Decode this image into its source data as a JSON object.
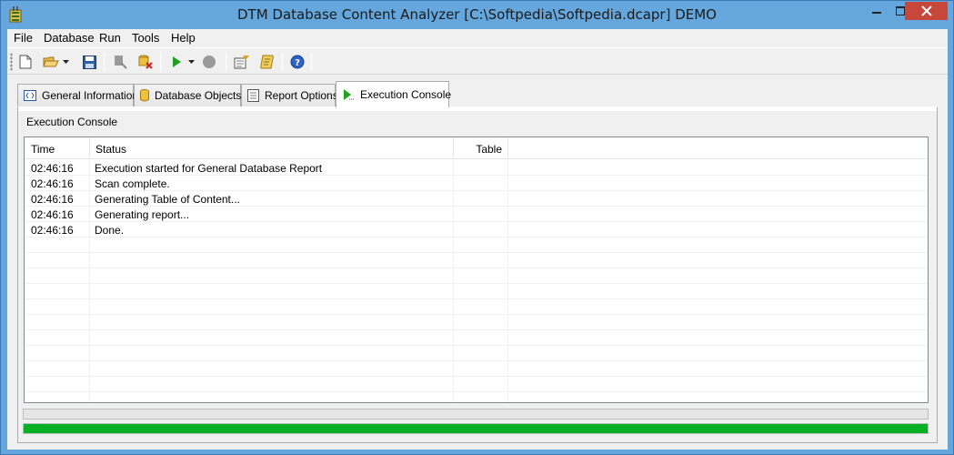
{
  "window": {
    "title": "DTM Database Content Analyzer [C:\\Softpedia\\Softpedia.dcapr] DEMO"
  },
  "menu": {
    "items": [
      {
        "label": "File"
      },
      {
        "label": "Database"
      },
      {
        "label": "Run"
      },
      {
        "label": "Tools"
      },
      {
        "label": "Help"
      }
    ]
  },
  "toolbar": {
    "buttons": [
      "new-file-icon",
      "open-folder-icon",
      "dropdown-arrow-icon",
      "save-icon",
      "connect-database-icon",
      "disconnect-database-icon",
      "run-icon",
      "run-dropdown-icon",
      "stop-icon",
      "report-options-icon",
      "script-icon",
      "help-icon"
    ]
  },
  "tabs": [
    {
      "label": "General Information",
      "icon": "code-icon"
    },
    {
      "label": "Database Objects",
      "icon": "database-icon"
    },
    {
      "label": "Report Options",
      "icon": "report-icon"
    },
    {
      "label": "Execution Console",
      "icon": "console-run-icon",
      "active": true
    }
  ],
  "console": {
    "title": "Execution Console",
    "columns": [
      "Time",
      "Status",
      "Table"
    ],
    "rows": [
      {
        "time": "02:46:16",
        "status": "Execution started for General Database Report",
        "table": ""
      },
      {
        "time": "02:46:16",
        "status": "Scan complete.",
        "table": ""
      },
      {
        "time": "02:46:16",
        "status": "Generating Table of Content...",
        "table": ""
      },
      {
        "time": "02:46:16",
        "status": "Generating report...",
        "table": ""
      },
      {
        "time": "02:46:16",
        "status": "Done.",
        "table": ""
      }
    ]
  },
  "progress": {
    "bar1": 0,
    "bar2": 1.0,
    "color": "#06b025"
  },
  "colors": {
    "titlebar": "#65a7dc",
    "close_button": "#c7473b"
  }
}
